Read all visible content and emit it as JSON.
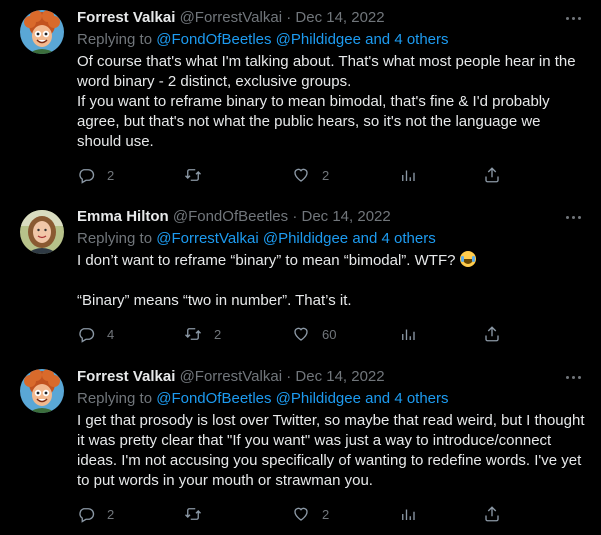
{
  "tweets": [
    {
      "name": "Forrest Valkai",
      "handle": "@ForrestValkai",
      "dot": "·",
      "date": "Dec 14, 2022",
      "replying_prefix": "Replying to ",
      "replying_users": "@FondOfBeetles @Phildidgee",
      "replying_others": "and 4 others",
      "lines": [
        "Of course that's what I'm talking about. That's what most people hear in the word binary - 2 distinct, exclusive groups.",
        "If you want to reframe binary to mean bimodal, that's fine & I'd probably agree, but that's not what the public hears, so it's not the language we should use."
      ],
      "replies": "2",
      "retweets": "",
      "likes": "2",
      "avatar_icon": "cartoon-avatar"
    },
    {
      "name": "Emma Hilton",
      "handle": "@FondOfBeetles",
      "dot": "·",
      "date": "Dec 14, 2022",
      "replying_prefix": "Replying to ",
      "replying_users": "@ForrestValkai @Phildidgee",
      "replying_others": "and 4 others",
      "lines": [
        "I don’t want to reframe “binary” to mean “bimodal”. WTF? ",
        "",
        "“Binary” means “two in number”. That’s it."
      ],
      "emoji": "face-with-tears-of-joy",
      "replies": "4",
      "retweets": "2",
      "likes": "60",
      "avatar_icon": "photo-avatar"
    },
    {
      "name": "Forrest Valkai",
      "handle": "@ForrestValkai",
      "dot": "·",
      "date": "Dec 14, 2022",
      "replying_prefix": "Replying to ",
      "replying_users": "@FondOfBeetles @Phildidgee",
      "replying_others": "and 4 others",
      "lines": [
        "I get that prosody is lost over Twitter, so maybe that read weird, but I thought it was pretty clear that \"If you want\" was just a way to introduce/connect ideas. I'm not accusing you specifically of wanting to redefine words. I've yet to put words in your mouth or strawman you."
      ],
      "replies": "2",
      "retweets": "",
      "likes": "2",
      "avatar_icon": "cartoon-avatar"
    }
  ],
  "colors": {
    "background": "#000000",
    "text": "#e7e9ea",
    "muted": "#71767b",
    "link": "#1d9bf0"
  }
}
